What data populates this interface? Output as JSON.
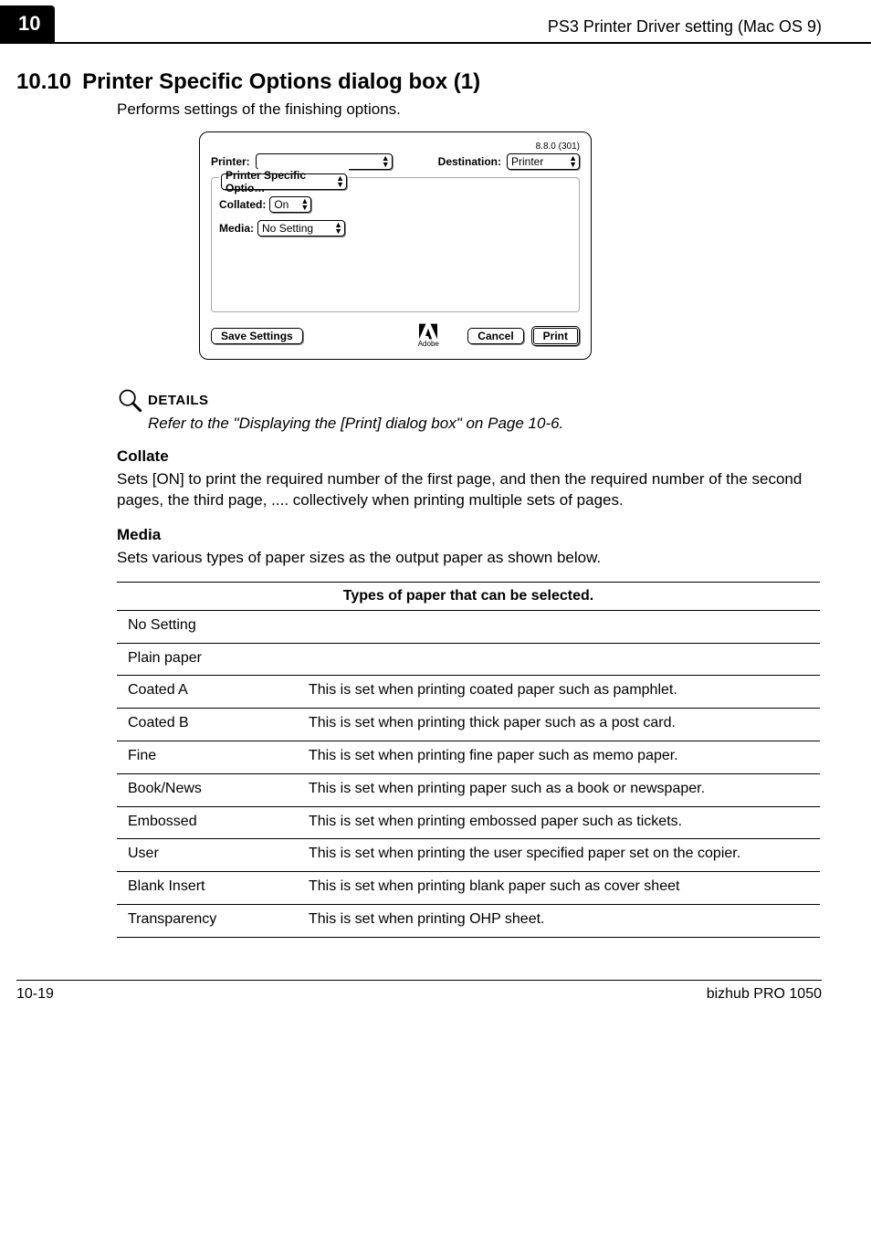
{
  "header": {
    "chapter": "10",
    "title": "PS3 Printer Driver setting (Mac OS 9)"
  },
  "section": {
    "number": "10.10",
    "title": "Printer Specific Options dialog box (1)",
    "intro": "Performs settings of the finishing options."
  },
  "dialog": {
    "version": "8.8.0 (301)",
    "printer_label": "Printer:",
    "destination_label": "Destination:",
    "destination_value": "Printer",
    "category_value": "Printer Specific Optio…",
    "collated_label": "Collated:",
    "collated_value": "On",
    "media_label": "Media:",
    "media_value": "No Setting",
    "save_btn": "Save Settings",
    "adobe_caption": "Adobe",
    "cancel_btn": "Cancel",
    "print_btn": "Print"
  },
  "details": {
    "label": "DETAILS",
    "text": "Refer to the \"Displaying the [Print] dialog box\" on Page 10-6."
  },
  "collate": {
    "heading": "Collate",
    "body": "Sets [ON] to print the required number of the first page, and then the required number of the second pages, the third page, .... collectively when printing multiple sets of pages."
  },
  "media": {
    "heading": "Media",
    "body": "Sets various types of paper sizes as the output paper as shown below."
  },
  "table": {
    "caption": "Types of paper that can be selected.",
    "rows": [
      {
        "name": "No Setting",
        "desc": ""
      },
      {
        "name": "Plain paper",
        "desc": ""
      },
      {
        "name": "Coated A",
        "desc": "This is set when printing coated paper such as pamphlet."
      },
      {
        "name": "Coated B",
        "desc": "This is set when printing thick paper such as a post card."
      },
      {
        "name": "Fine",
        "desc": "This is set when printing fine paper such as memo paper."
      },
      {
        "name": "Book/News",
        "desc": "This is set when printing paper such as a book or newspaper."
      },
      {
        "name": "Embossed",
        "desc": "This is set when printing embossed paper such as tickets."
      },
      {
        "name": "User",
        "desc": "This is set when printing the user specified paper set on the copier."
      },
      {
        "name": "Blank Insert",
        "desc": "This is set when printing blank paper such as cover sheet"
      },
      {
        "name": "Transparency",
        "desc": "This is set when printing OHP sheet."
      }
    ]
  },
  "footer": {
    "page": "10-19",
    "product": "bizhub PRO 1050"
  }
}
